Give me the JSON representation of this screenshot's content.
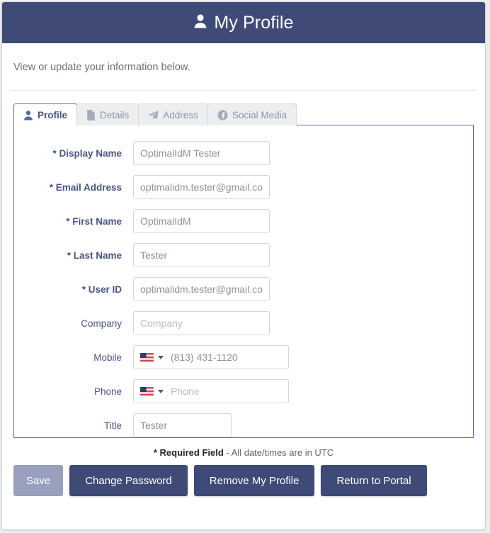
{
  "header": {
    "title": "My Profile",
    "icon": "user-icon",
    "background_color": "#3f4a77"
  },
  "subtitle": "View or update your information below.",
  "tabs": [
    {
      "label": "Profile",
      "icon": "user-icon",
      "active": true
    },
    {
      "label": "Details",
      "icon": "document-icon",
      "active": false
    },
    {
      "label": "Address",
      "icon": "paper-plane-icon",
      "active": false
    },
    {
      "label": "Social Media",
      "icon": "facebook-icon",
      "active": false
    }
  ],
  "form": {
    "fields": [
      {
        "label": "Display Name",
        "required": true,
        "value": "OptimalIdM Tester",
        "placeholder": "Display Name",
        "type": "text",
        "width": "w-193"
      },
      {
        "label": "Email Address",
        "required": true,
        "value": "optimalidm.tester@gmail.com",
        "placeholder": "Email Address",
        "type": "text",
        "width": "w-193"
      },
      {
        "label": "First Name",
        "required": true,
        "value": "OptimalIdM",
        "placeholder": "First Name",
        "type": "text",
        "width": "w-193"
      },
      {
        "label": "Last Name",
        "required": true,
        "value": "Tester",
        "placeholder": "Last Name",
        "type": "text",
        "width": "w-193"
      },
      {
        "label": "User ID",
        "required": true,
        "value": "optimalidm.tester@gmail.com",
        "placeholder": "User ID",
        "type": "text",
        "width": "w-193"
      },
      {
        "label": "Company",
        "required": false,
        "value": "",
        "placeholder": "Company",
        "type": "text",
        "width": "w-193"
      },
      {
        "label": "Mobile",
        "required": false,
        "value": "(813) 431-1120",
        "placeholder": "Mobile",
        "type": "phone",
        "country": "us"
      },
      {
        "label": "Phone",
        "required": false,
        "value": "",
        "placeholder": "Phone",
        "type": "phone",
        "country": "us"
      },
      {
        "label": "Title",
        "required": false,
        "value": "Tester",
        "placeholder": "Title",
        "type": "text",
        "width": "w-139"
      }
    ]
  },
  "footer": {
    "required_note_bold": "* Required Field",
    "required_note_rest": " - All date/times are in UTC",
    "buttons": [
      {
        "label": "Save",
        "disabled": true
      },
      {
        "label": "Change Password",
        "disabled": false
      },
      {
        "label": "Remove My Profile",
        "disabled": false
      },
      {
        "label": "Return to Portal",
        "disabled": false
      }
    ]
  },
  "colors": {
    "primary": "#3f4a77",
    "tab_border": "#5b6a9c",
    "label": "#4a5580",
    "disabled_button": "#98a0bd"
  }
}
